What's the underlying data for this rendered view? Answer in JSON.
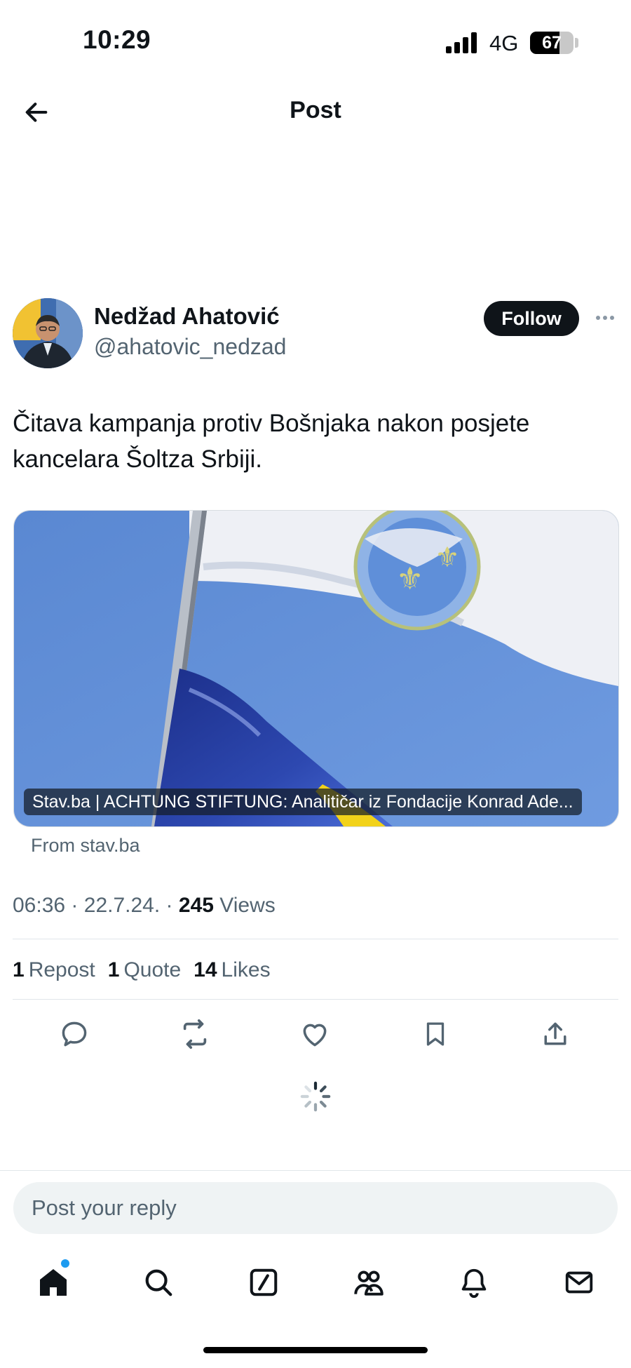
{
  "status_bar": {
    "time": "10:29",
    "network": "4G",
    "battery": "67",
    "battery_level_percent": 67
  },
  "header": {
    "title": "Post",
    "back_icon": "arrow-left-icon"
  },
  "post": {
    "author": {
      "name": "Nedžad Ahatović",
      "handle": "@ahatovic_nedzad"
    },
    "follow_label": "Follow",
    "text": "Čitava kampanja protiv Bošnjaka nakon posjete kancelara Šoltza Srbiji.",
    "card": {
      "caption": "Stav.ba | ACHTUNG STIFTUNG: Analitičar iz Fondacije Konrad Ade...",
      "from": "From stav.ba"
    },
    "meta": {
      "time": "06:36",
      "date": "22.7.24.",
      "separator": "·",
      "views_count": "245",
      "views_label": "Views"
    },
    "stats": [
      {
        "count": "1",
        "label": "Repost"
      },
      {
        "count": "1",
        "label": "Quote"
      },
      {
        "count": "14",
        "label": "Likes"
      }
    ],
    "actions": [
      "reply-icon",
      "repost-icon",
      "like-icon",
      "bookmark-icon",
      "share-icon"
    ]
  },
  "reply": {
    "placeholder": "Post your reply"
  },
  "bottom_nav": [
    "home-icon",
    "search-icon",
    "compose-icon",
    "communities-icon",
    "notifications-icon",
    "messages-icon"
  ],
  "colors": {
    "text": "#0f1419",
    "secondary": "#536471",
    "accent": "#1d9bf0",
    "divider": "#e1e6ea"
  }
}
